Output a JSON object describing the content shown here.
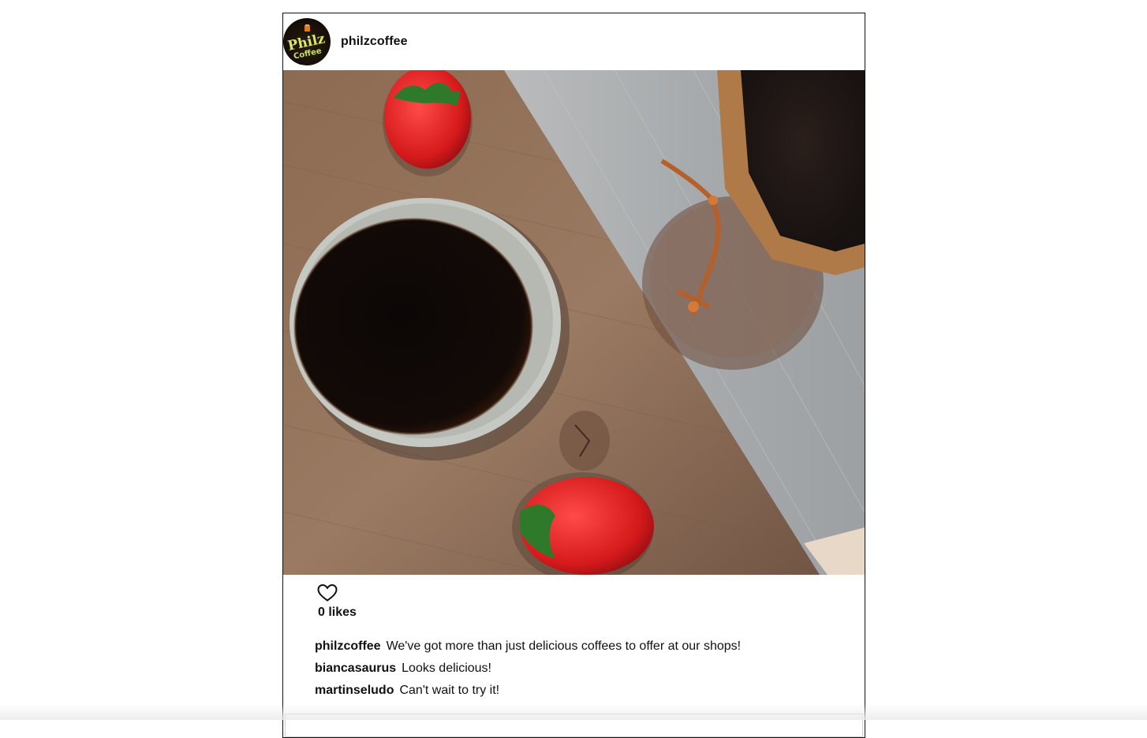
{
  "post": {
    "username": "philzcoffee",
    "avatar_icon": "philz-coffee-logo",
    "image_description_icon": "coffee-cup-strawberries-photo",
    "likes_label": "0 likes",
    "like_icon": "heart-outline-icon",
    "comments": [
      {
        "user": "philzcoffee",
        "text": "We've got more than just delicious coffees to offer at our shops!"
      },
      {
        "user": "biancasaurus",
        "text": "Looks delicious!"
      },
      {
        "user": "martinseludo",
        "text": "Can't wait to try it!"
      }
    ]
  },
  "colors": {
    "border": "#111111",
    "text": "#111111",
    "input_border": "#cfcfcf"
  }
}
